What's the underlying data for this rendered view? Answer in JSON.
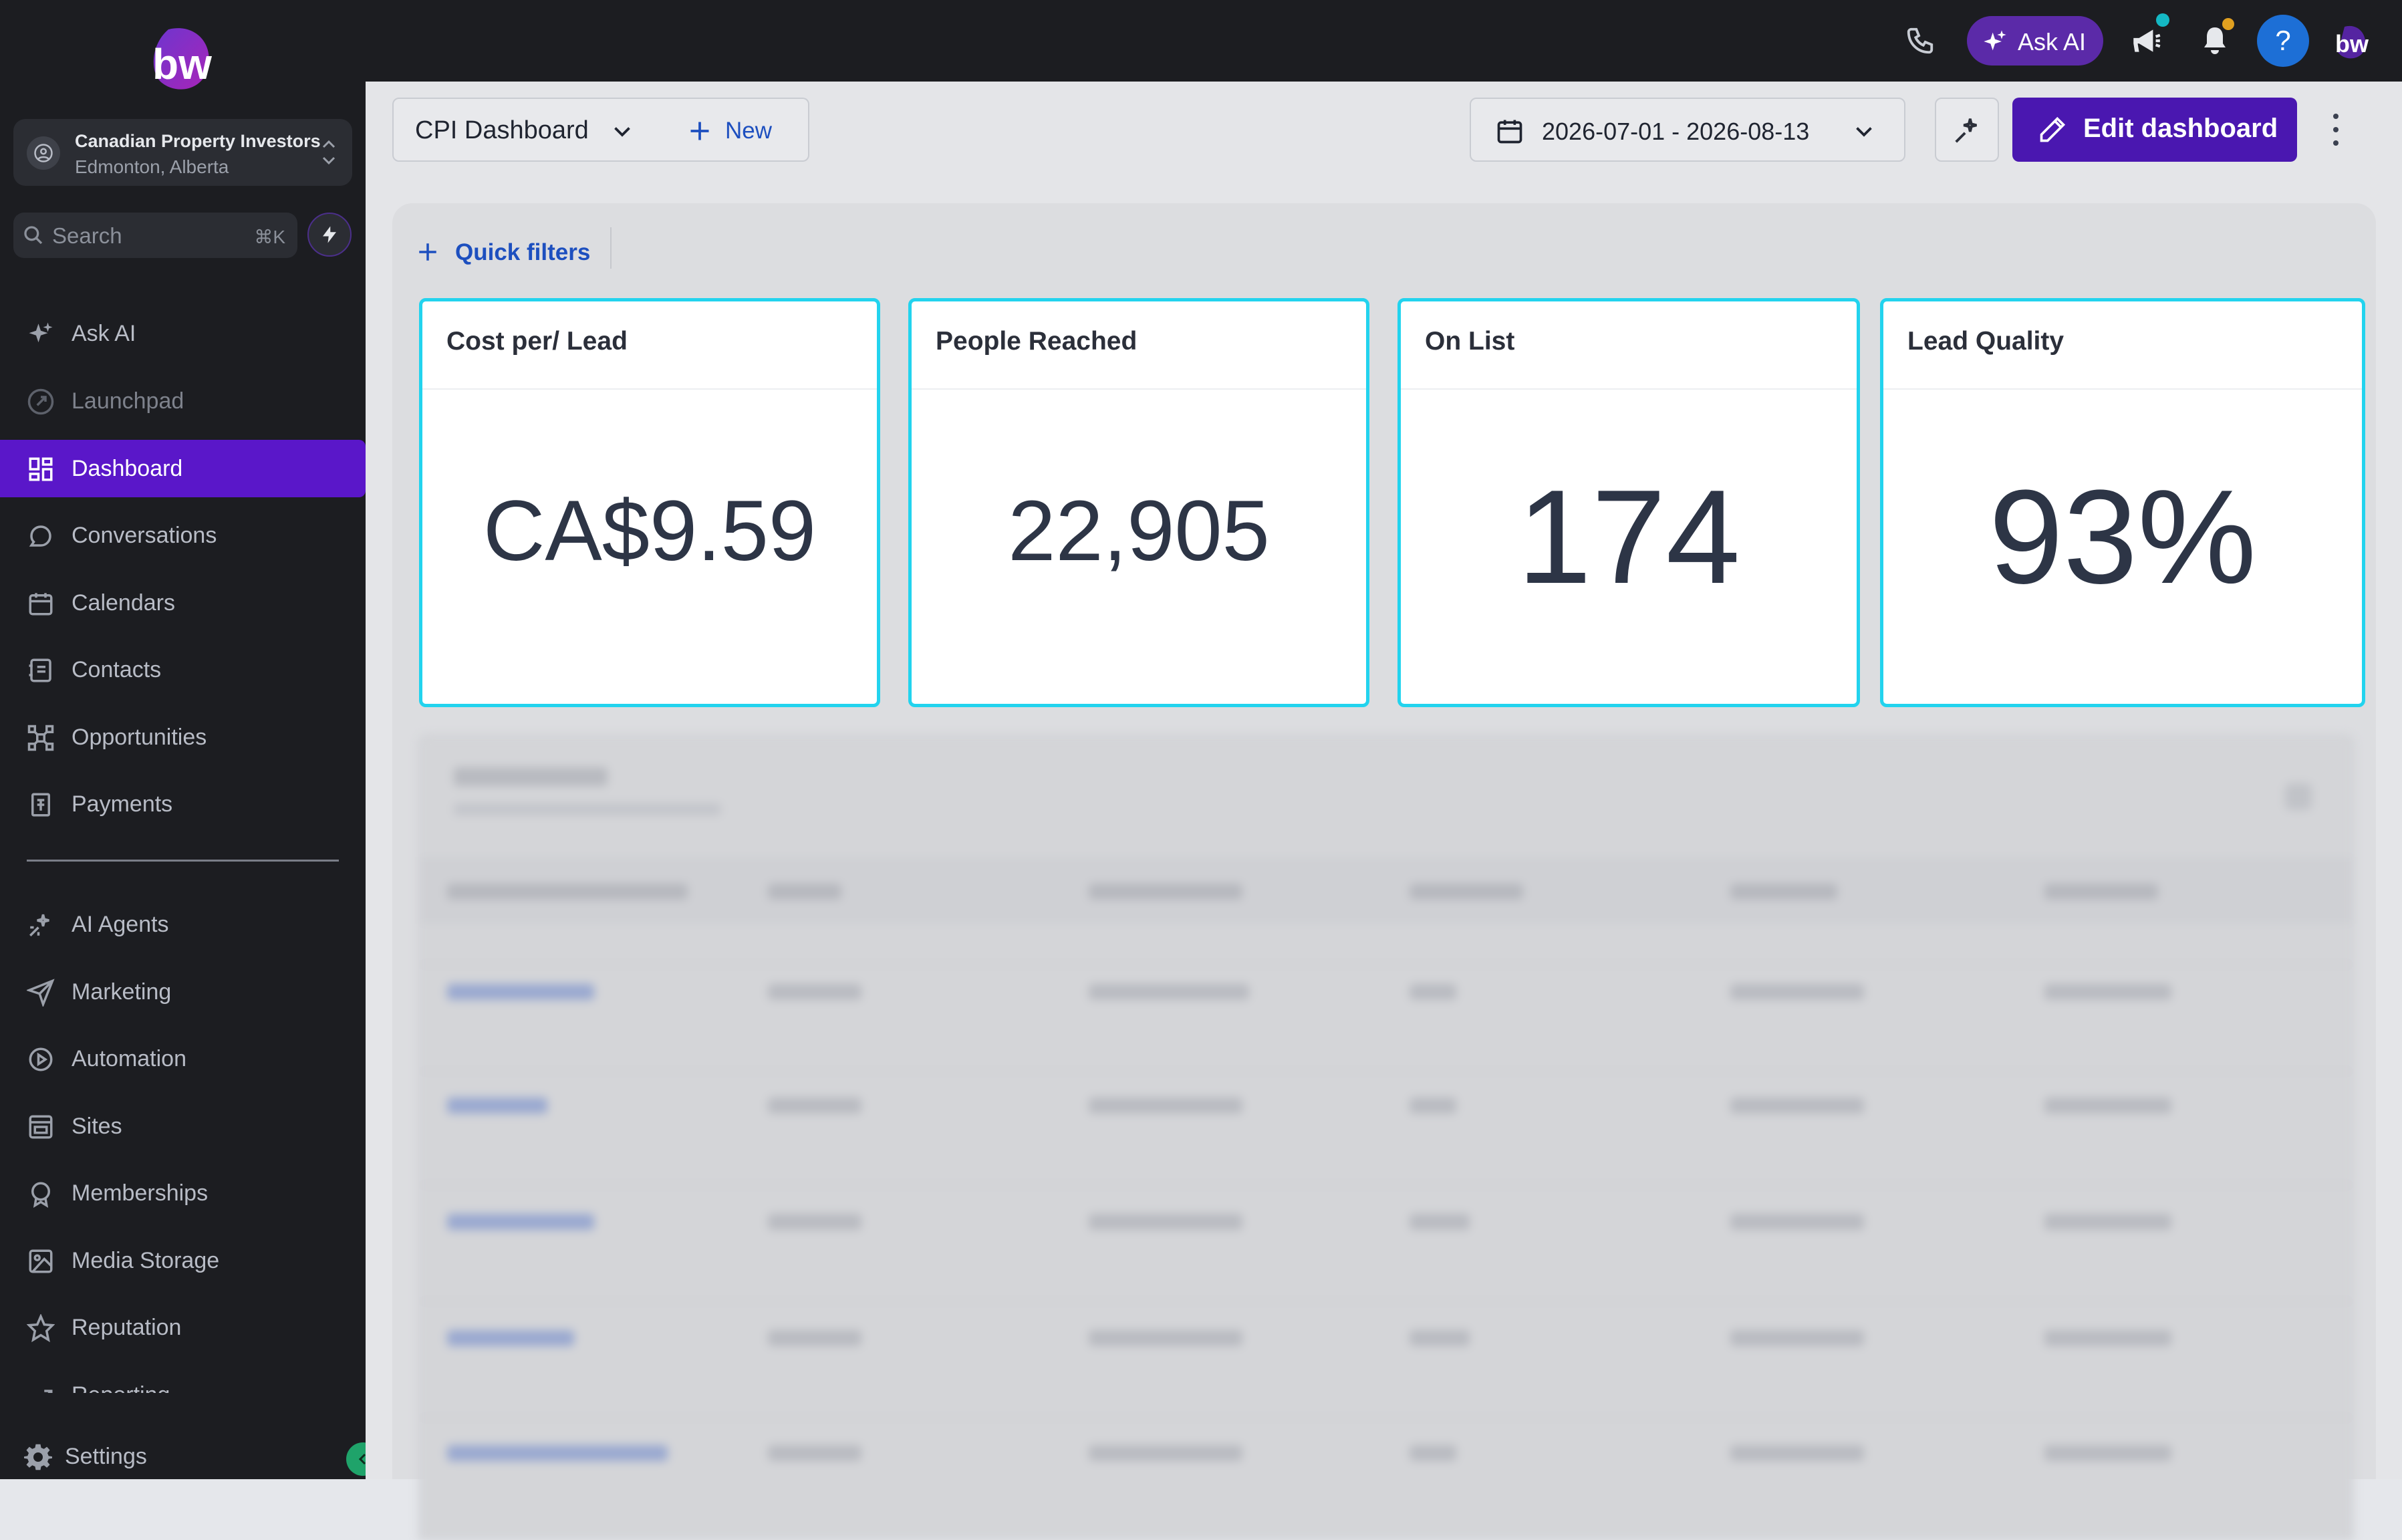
{
  "account": {
    "name": "Canadian Property Investors",
    "location": "Edmonton, Alberta"
  },
  "search": {
    "placeholder": "Search",
    "shortcut": "⌘K"
  },
  "sidebar": {
    "items": [
      {
        "label": "Ask AI",
        "icon": "sparkles-icon"
      },
      {
        "label": "Launchpad",
        "icon": "rocket-icon"
      },
      {
        "label": "Dashboard",
        "icon": "grid-icon",
        "active": true
      },
      {
        "label": "Conversations",
        "icon": "chat-icon"
      },
      {
        "label": "Calendars",
        "icon": "calendar-icon"
      },
      {
        "label": "Contacts",
        "icon": "contacts-icon"
      },
      {
        "label": "Opportunities",
        "icon": "network-icon"
      },
      {
        "label": "Payments",
        "icon": "receipt-icon"
      },
      {
        "label": "AI Agents",
        "icon": "ai-agents-icon"
      },
      {
        "label": "Marketing",
        "icon": "send-icon"
      },
      {
        "label": "Automation",
        "icon": "automation-icon"
      },
      {
        "label": "Sites",
        "icon": "sites-icon"
      },
      {
        "label": "Memberships",
        "icon": "award-icon"
      },
      {
        "label": "Media Storage",
        "icon": "image-icon"
      },
      {
        "label": "Reputation",
        "icon": "star-icon"
      },
      {
        "label": "Reporting",
        "icon": "trend-icon"
      }
    ],
    "settings_label": "Settings"
  },
  "topbar": {
    "ask_ai_label": "Ask AI",
    "help_label": "?"
  },
  "toolbar": {
    "dashboard_name": "CPI Dashboard",
    "new_label": "New",
    "date_range": "2026-07-01 - 2026-08-13",
    "edit_label": "Edit dashboard"
  },
  "filters": {
    "quick_filters_label": "Quick filters"
  },
  "kpis": [
    {
      "title": "Cost per/ Lead",
      "value": "CA$9.59"
    },
    {
      "title": "People Reached",
      "value": "22,905"
    },
    {
      "title": "On List",
      "value": "174"
    },
    {
      "title": "Lead Quality",
      "value": "93%"
    }
  ],
  "colors": {
    "accent": "#5a17c9",
    "edit_button": "#4a17b0",
    "kpi_border": "#22d3ee",
    "link": "#1d4fbf",
    "help": "#1d6fd6"
  }
}
